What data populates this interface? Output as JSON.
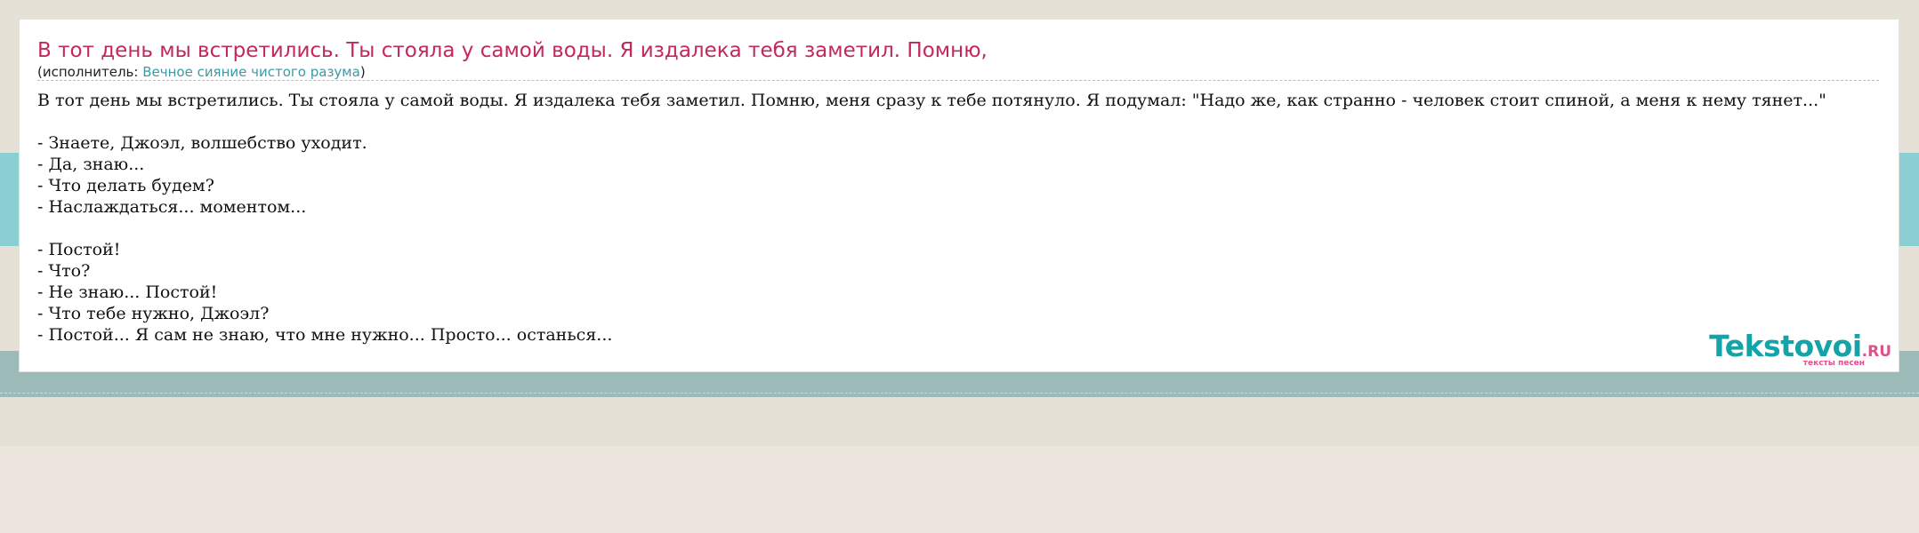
{
  "song": {
    "title": "В тот день мы встретились. Ты стояла у самой воды. Я издалека тебя заметил. Помню,",
    "performer_prefix": "(исполнитель: ",
    "performer_name": "Вечное сияние чистого разума",
    "performer_suffix": ")"
  },
  "lyrics": {
    "intro": "В тот день мы встретились. Ты стояла у самой воды. Я издалека тебя заметил. Помню, меня сразу к тебе потянуло. Я подумал: \"Надо же, как странно - человек стоит спиной, а меня к нему тянет...\"",
    "stanza1": [
      "- Знаете, Джоэл, волшебство уходит.",
      "- Да, знаю...",
      "- Что делать будем?",
      "- Наслаждаться... моментом..."
    ],
    "stanza2": [
      "- Постой!",
      "- Что?",
      "- Не знаю... Постой!",
      "- Что тебе нужно, Джоэл?",
      "- Постой... Я сам не знаю, что мне нужно... Просто... останься..."
    ]
  },
  "logo": {
    "main": "Tekstovoi",
    "domain": ".RU",
    "tagline": "тексты песен"
  },
  "colors": {
    "title": "#c2285f",
    "link": "#3a9aa6",
    "logo_main": "#14a3a8",
    "logo_accent": "#e0508c"
  }
}
